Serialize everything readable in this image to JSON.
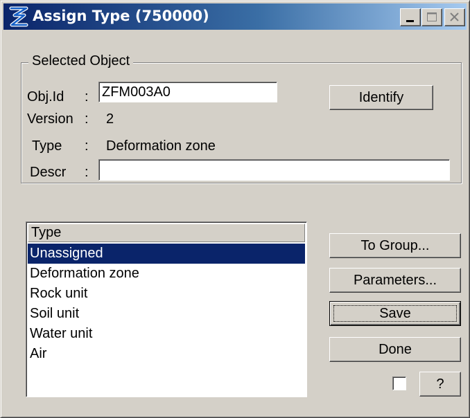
{
  "window": {
    "title": "Assign Type (750000)"
  },
  "selected_object": {
    "legend": "Selected Object",
    "objid_label": "Obj.Id",
    "objid_value": "ZFM003A0",
    "version_label": "Version",
    "version_value": "2",
    "type_label": "Type",
    "type_value": "Deformation zone",
    "descr_label": "Descr",
    "descr_value": "",
    "colon": ":",
    "identify_label": "Identify"
  },
  "type_list": {
    "header": "Type",
    "items": [
      "Unassigned",
      "Deformation zone",
      "Rock unit",
      "Soil unit",
      "Water unit",
      "Air"
    ],
    "selected_index": 0
  },
  "buttons": {
    "to_group": "To Group...",
    "parameters": "Parameters...",
    "save": "Save",
    "done": "Done",
    "help": "?"
  },
  "checkbox": {
    "checked": false
  },
  "colors": {
    "face": "#d4d0c8",
    "title_start": "#0a246a",
    "title_end": "#a6caf0",
    "selection": "#0a246a"
  }
}
